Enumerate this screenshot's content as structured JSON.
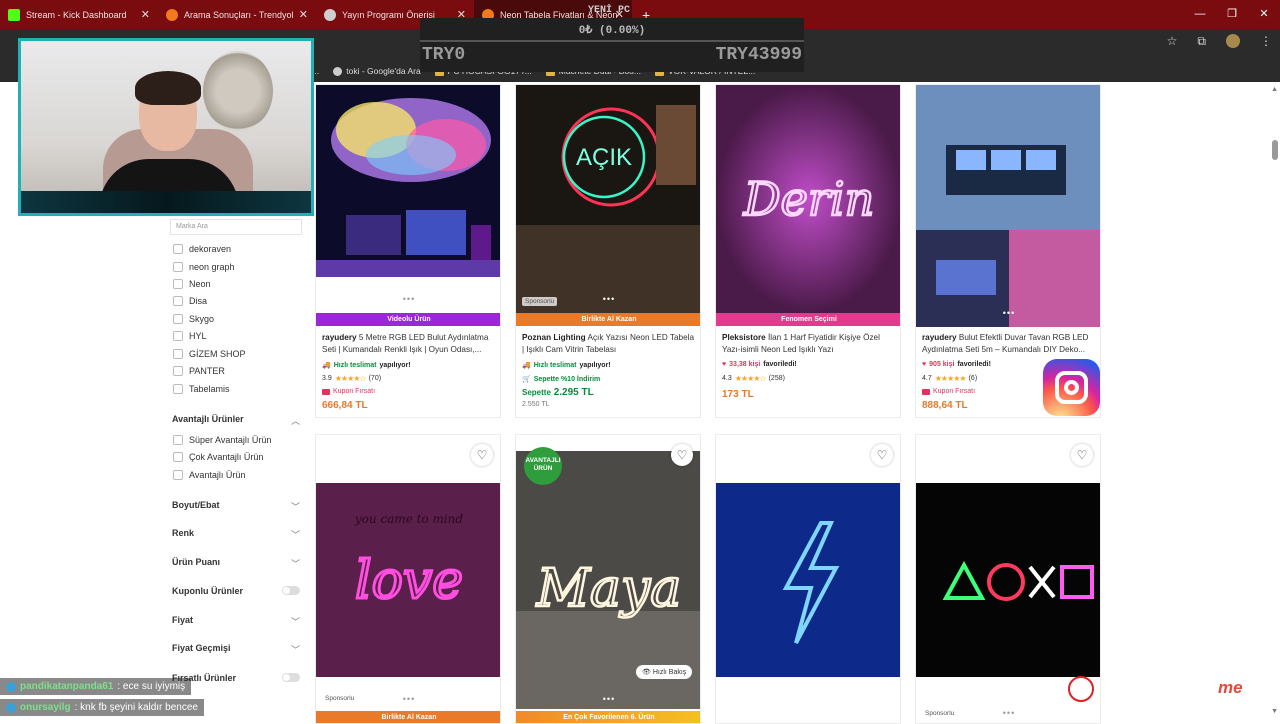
{
  "browser": {
    "tabs": [
      {
        "label": "Stream - Kick Dashboard",
        "color": "#53fc18"
      },
      {
        "label": "Arama Sonuçları - Trendyol",
        "color": "#f27a1a"
      },
      {
        "label": "Yayın Programı Önerisi",
        "color": "#cfcfcf"
      },
      {
        "label": "Neon Tabela Fiyatları & Neon",
        "color": "#f27a1a"
      }
    ],
    "bookmarks": [
      "toki - Google'da Ara",
      "PC HOCASI-GG17 /...",
      "Machete Dual - Boo...",
      "VOK-VALOR / INTEL..."
    ],
    "bookmark_left": "dbo..."
  },
  "overlay": {
    "title": "YENİ PC",
    "progress_text": "0₺ (0.00%)",
    "progress": 0,
    "left_value": "TRY0",
    "right_value": "TRY43999"
  },
  "filters": {
    "brand_search_placeholder": "Marka Ara",
    "brands": [
      "dekoraven",
      "neon graph",
      "Neon",
      "Disa",
      "Skygo",
      "HYL",
      "GİZEM SHOP",
      "PANTER",
      "Tabelamis"
    ],
    "advantage_title": "Avantajlı Ürünler",
    "advantage_items": [
      "Süper Avantajlı Ürün",
      "Çok Avantajlı Ürün",
      "Avantajlı Ürün"
    ],
    "sections": [
      "Boyut/Ebat",
      "Renk",
      "Ürün Puanı",
      "Kuponlu Ürünler",
      "Fiyat",
      "Fiyat Geçmişi",
      "Fırsatlı Ürünler"
    ]
  },
  "products": [
    {
      "band": "Videolu Ürün",
      "brand": "rayudery",
      "title": "5 Metre RGB LED Bulut Aydınlatma Seti | Kumandalı Renkli Işık | Oyun Odası,...",
      "delivery_fast": "Hızlı teslimat",
      "delivery_rest": "yapılıyor!",
      "rating": "3.9",
      "rating_value": 3.9,
      "reviews": "(70)",
      "coupon": "Kupon Fırsatı",
      "price": "666,84 TL"
    },
    {
      "band": "Birlikte Al Kazan",
      "sponsored": "Sponsorlu",
      "brand": "Poznan Lighting",
      "title": "Açık Yazısı Neon LED Tabela | Işıklı Cam Vitrin Tabelası",
      "delivery_fast": "Hızlı teslimat",
      "delivery_rest": "yapılıyor!",
      "discount": "Sepette %10 İndirim",
      "price_label": "Sepette",
      "price": "2.295 TL",
      "old_price": "2.550 TL",
      "sign_text": "AÇIK"
    },
    {
      "band": "Fenomen Seçimi",
      "brand": "Pleksistore",
      "title": "İlan 1 Harf Fiyatidir Kişiye Özel Yazı-isimli Neon Led Işıklı Yazı",
      "favorites": "33,38 kişi",
      "favorites_rest": "favoriledi!",
      "rating": "4.3",
      "rating_value": 4.3,
      "reviews": "(258)",
      "price": "173 TL",
      "sign_text": "Derin"
    },
    {
      "brand": "rayudery",
      "title": "Bulut Efektli Duvar Tavan RGB LED Aydınlatma Seti 5m – Kumandalı DIY Deko...",
      "favorites": "905 kişi",
      "favorites_rest": "favoriledi!",
      "rating": "4.7",
      "rating_value": 4.7,
      "reviews": "(6)",
      "coupon": "Kupon Fırsatı",
      "price": "888,64 TL"
    },
    {
      "band": "Birlikte Al Kazan",
      "sponsored": "Sponsorlu",
      "sign_text": "love",
      "wall_text": "you came to mind"
    },
    {
      "band": "En Çok Favorilenen 6. Ürün",
      "badge": "AVANTAJLI ÜRÜN",
      "quick_view": "Hızlı Bakış",
      "sign_text": "Maya"
    },
    {},
    {
      "sponsored": "Sponsorlu"
    }
  ],
  "chat": [
    {
      "user": "pandikatanpanda61",
      "message": ": ece su iyiymiş"
    },
    {
      "user": "onursayilg",
      "message": ": knk fb şeyini kaldır bencee"
    }
  ],
  "icons": [
    "close-icon",
    "plus-icon",
    "star-icon",
    "extension-icon",
    "heart-icon",
    "eye-icon",
    "instagram-icon"
  ]
}
